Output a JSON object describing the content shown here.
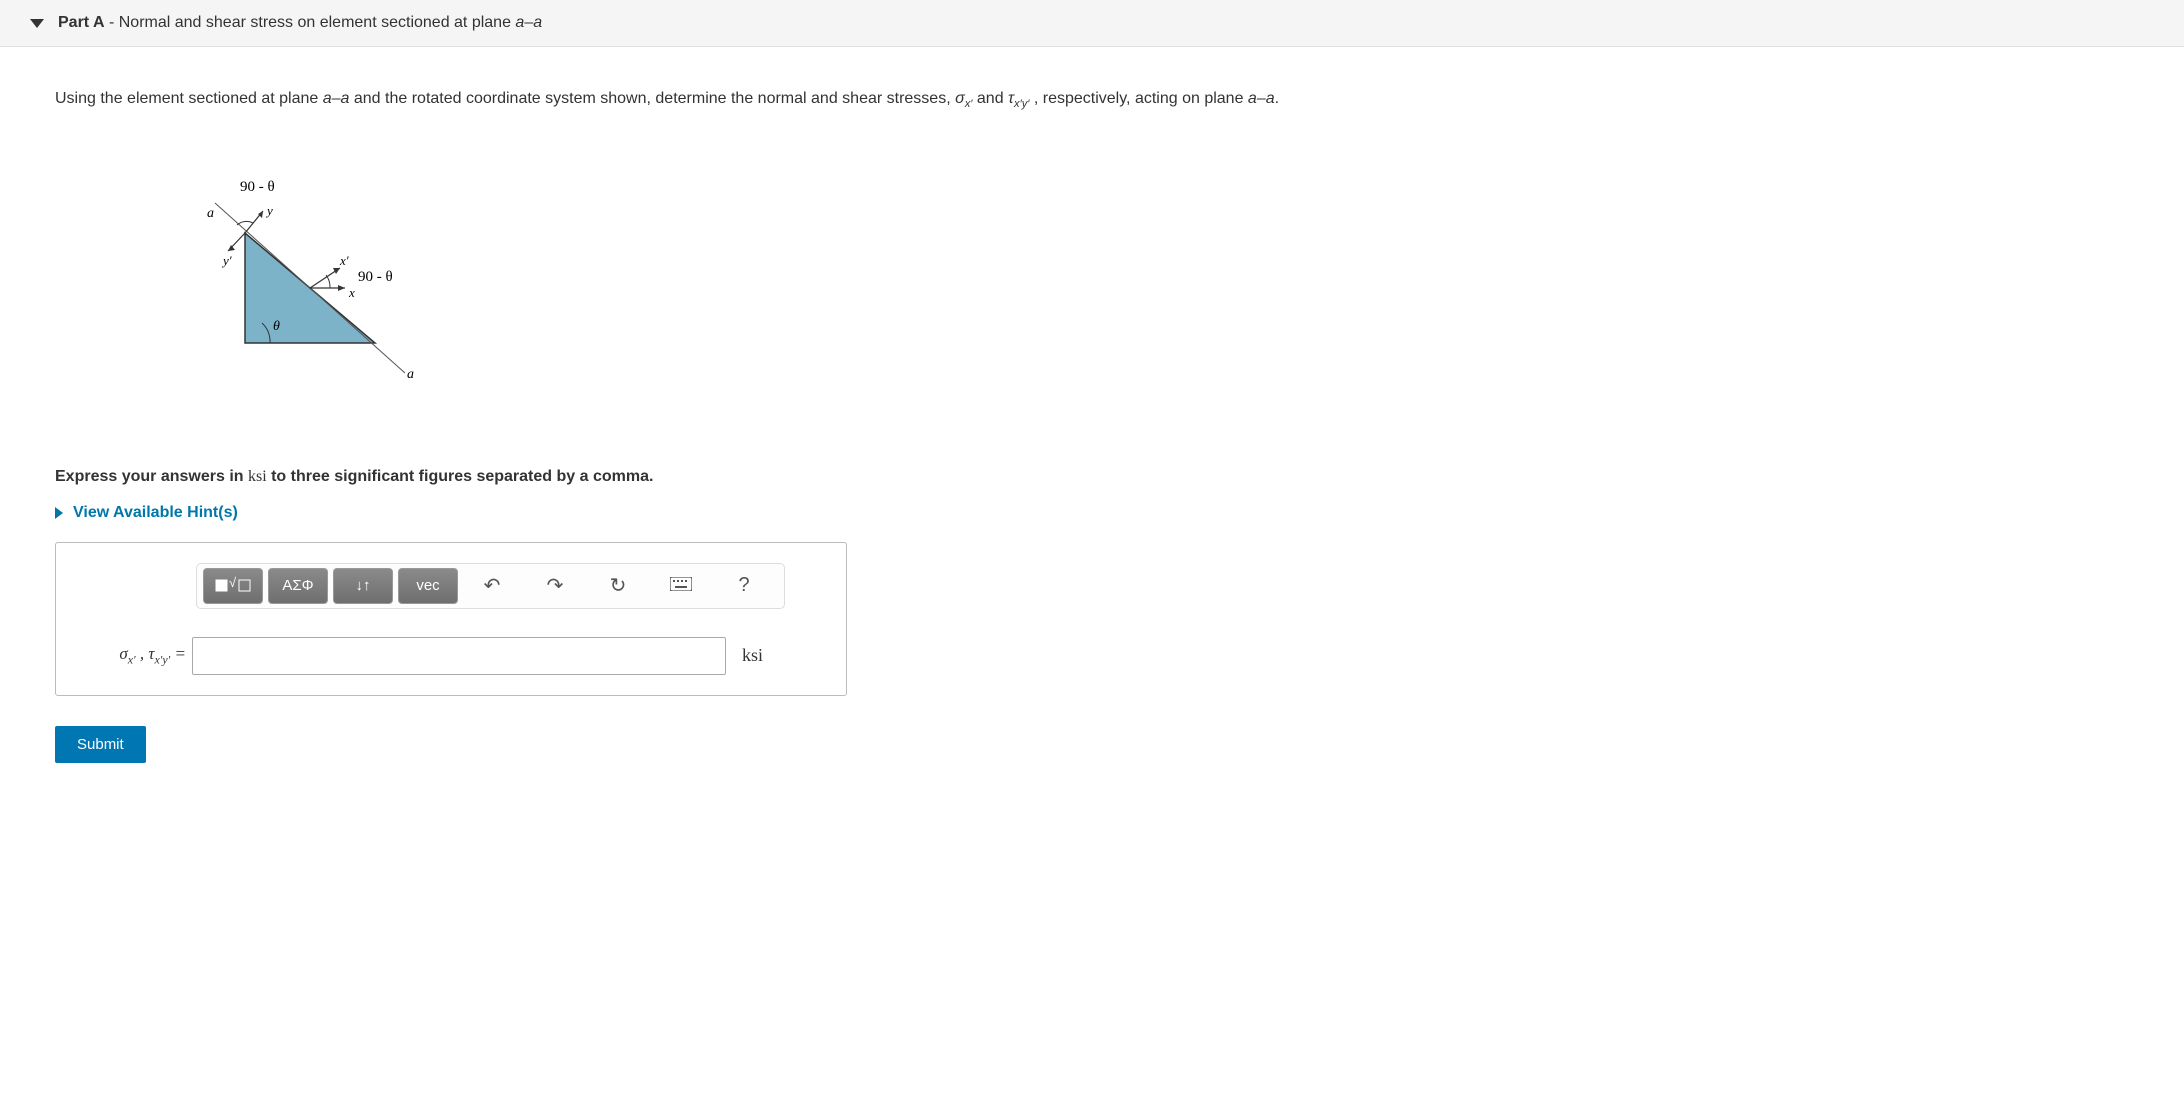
{
  "header": {
    "part_label": "Part A",
    "separator": " - ",
    "title_text": "Normal and shear stress on element sectioned at plane ",
    "plane_label": "a–a"
  },
  "question": {
    "prefix": "Using the element sectioned at plane ",
    "plane1": "a–a",
    "mid1": " and the rotated coordinate system shown, determine the normal and shear stresses, ",
    "sigma": "σ",
    "sigma_sub": "x′",
    "and_word": " and ",
    "tau": "τ",
    "tau_sub": "x′y′",
    "mid2": " , respectively, acting on plane ",
    "plane2": "a–a",
    "end": "."
  },
  "diagram": {
    "label_90_theta_top": "90 - θ",
    "label_90_theta_right": "90 - θ",
    "label_a_top": "a",
    "label_a_bottom": "a",
    "label_y": "y",
    "label_yprime": "y′",
    "label_xprime": "x′",
    "label_x": "x",
    "label_theta": "θ"
  },
  "instruction": {
    "pre": "Express your answers in ",
    "unit": "ksi",
    "post": " to three significant figures separated by a comma."
  },
  "hints_link": "View Available Hint(s)",
  "toolbar": {
    "templates": "▢√▢",
    "greek": "ΑΣΦ",
    "subsup": "↓↑",
    "vec": "vec",
    "undo": "↶",
    "redo": "↷",
    "reset": "↻",
    "keyboard": "⌨",
    "help": "?"
  },
  "answer": {
    "label_sigma": "σ",
    "label_sigma_sub": "x′",
    "label_sep": " , ",
    "label_tau": "τ",
    "label_tau_sub": "x′y′",
    "equals": " =",
    "value": "",
    "unit": "ksi"
  },
  "submit_label": "Submit"
}
